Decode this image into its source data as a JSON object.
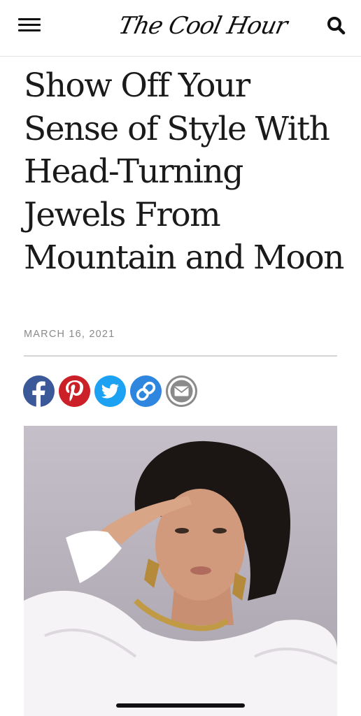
{
  "header": {
    "logo_text": "The Cool Hour"
  },
  "article": {
    "title": "Show Off Your Sense of Style With Head-Turning Jewels From Mountain and Moon",
    "date": "MARCH 16, 2021"
  },
  "share": [
    {
      "icon": "facebook-icon",
      "color": "#3b5998"
    },
    {
      "icon": "pinterest-icon",
      "color": "#cb2027"
    },
    {
      "icon": "twitter-icon",
      "color": "#1da1f2"
    },
    {
      "icon": "link-icon",
      "color": "#2e86de"
    },
    {
      "icon": "email-icon",
      "color": "#8a8a8a"
    }
  ],
  "colors": {
    "text": "#1a1a1a",
    "date": "#8a8a8a",
    "divider": "#d5d5d5"
  }
}
